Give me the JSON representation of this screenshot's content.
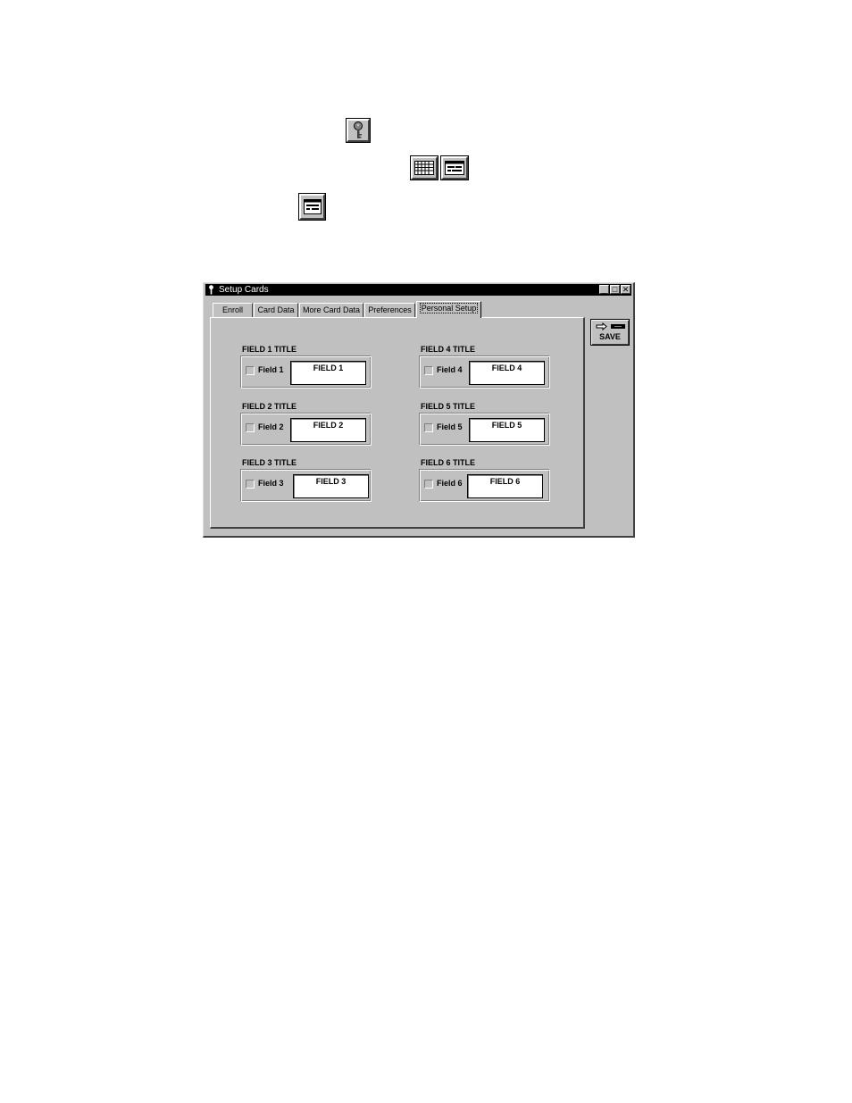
{
  "toolbar_icons": [
    {
      "icon": "key-icon"
    },
    {
      "icon": "grid-table-icon"
    },
    {
      "icon": "card-form-icon"
    },
    {
      "icon": "card-form-icon"
    }
  ],
  "window": {
    "title": "Setup Cards",
    "controls": {
      "minimize": "_",
      "maximize": "□",
      "close": "✕"
    }
  },
  "tabs": [
    {
      "label": "Enroll"
    },
    {
      "label": "Card Data"
    },
    {
      "label": "More Card Data"
    },
    {
      "label": "Preferences"
    },
    {
      "label": "Personal Setup",
      "active": true
    }
  ],
  "fields": [
    {
      "title": "FIELD 1 TITLE",
      "checkbox_label": "Field 1",
      "value": "FIELD 1",
      "checked": false
    },
    {
      "title": "FIELD 2 TITLE",
      "checkbox_label": "Field 2",
      "value": "FIELD 2",
      "checked": false
    },
    {
      "title": "FIELD 3 TITLE",
      "checkbox_label": "Field 3",
      "value": "FIELD 3",
      "checked": false
    },
    {
      "title": "FIELD 4 TITLE",
      "checkbox_label": "Field 4",
      "value": "FIELD 4",
      "checked": false
    },
    {
      "title": "FIELD 5 TITLE",
      "checkbox_label": "Field 5",
      "value": "FIELD 5",
      "checked": false
    },
    {
      "title": "FIELD 6 TITLE",
      "checkbox_label": "Field 6",
      "value": "FIELD 6",
      "checked": false
    }
  ],
  "save": {
    "label": "SAVE",
    "icon": "save-arrow-icon"
  }
}
